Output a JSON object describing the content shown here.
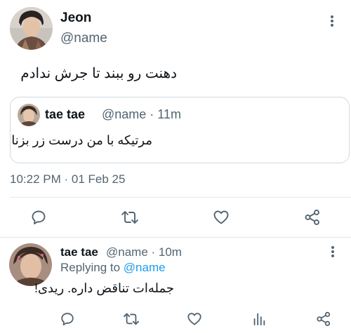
{
  "main_tweet": {
    "author_name": "Jeon",
    "author_handle": "@name",
    "text": "دهنت رو ببند تا جرش ندادم",
    "timestamp": "10:22 PM · 01 Feb 25",
    "quote": {
      "author_name": "tae tae",
      "meta": "@name · 11m",
      "text": "مرتیکه با من درست زر بزنا"
    }
  },
  "reply_tweet": {
    "author_name": "tae tae",
    "meta": "@name · 10m",
    "replying_prefix": "Replying to",
    "replying_to": "@name",
    "text": "جمله‌ات تناقض داره. ریدی!"
  },
  "icons": {
    "reply": "comment-bubble-icon",
    "retweet": "retweet-icon",
    "like": "heart-icon",
    "share": "share-nodes-icon",
    "stats": "bar-chart-icon",
    "more": "more-vertical-icon"
  },
  "colors": {
    "icon_gray": "#536471",
    "link_blue": "#1d9bf0",
    "border": "#cfd9de"
  }
}
